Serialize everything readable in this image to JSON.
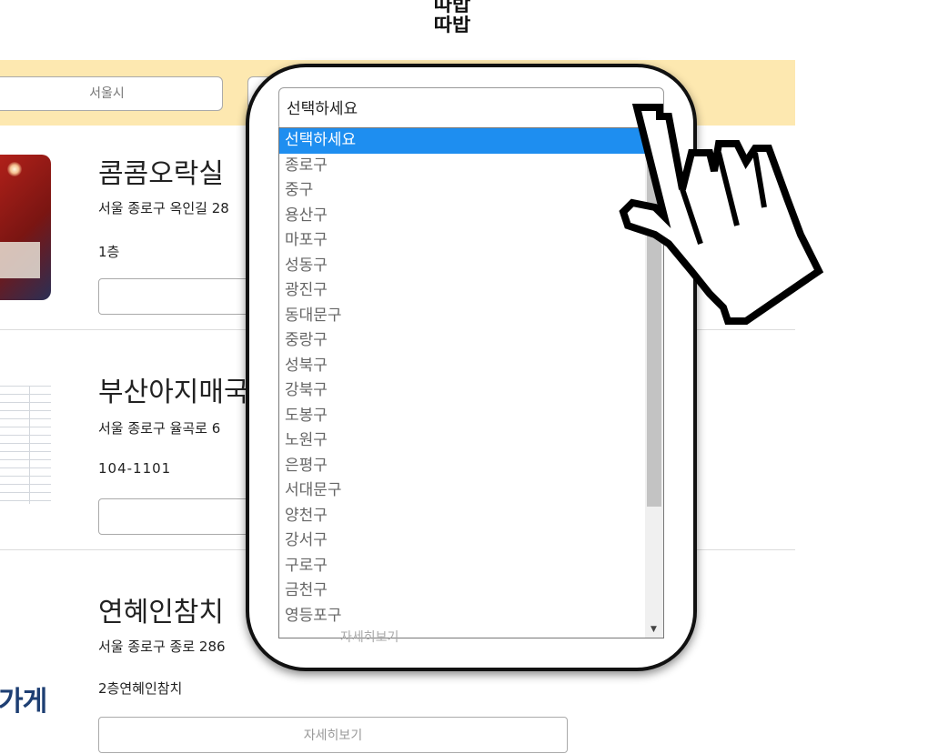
{
  "logo": {
    "line1": "따밥",
    "line2": "따밥"
  },
  "filter": {
    "city_value": "서울시",
    "district_value": "선택하세요"
  },
  "dropdown": {
    "options": [
      "선택하세요",
      "종로구",
      "중구",
      "용산구",
      "마포구",
      "성동구",
      "광진구",
      "동대문구",
      "중랑구",
      "성북구",
      "강북구",
      "도봉구",
      "노원구",
      "은평구",
      "서대문구",
      "양천구",
      "강서구",
      "구로구",
      "금천구",
      "영등포구"
    ],
    "selected_index": 0,
    "accent_color": "#1e8ef0"
  },
  "stores": [
    {
      "name": "콤콤오락실",
      "address": "서울 종로구 옥인길 28",
      "floor": "1층",
      "detail_label": ""
    },
    {
      "name": "부산아지매국",
      "address": "서울 종로구 율곡로 6",
      "floor": "104-1101",
      "detail_label": ""
    },
    {
      "name": "연혜인참치",
      "address": "서울 종로구 종로 286",
      "floor": "2층연혜인참치",
      "detail_label": "자세히보기"
    }
  ],
  "fragments": {
    "store3_logo": "가게",
    "behind_num": "8",
    "behind_char": "국",
    "under_btn": "자세히보기"
  }
}
